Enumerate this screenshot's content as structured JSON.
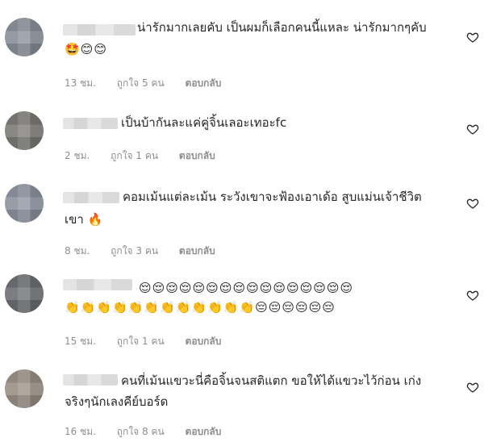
{
  "comments": [
    {
      "avatar_color": "#8a8f9a",
      "text_lines": [
        "น่ารักมากเลยคับ เป็นผมก็เลือกคนนี้แหละ น่ารักมากๆคับ"
      ],
      "emoji_line": "🤩😊😊",
      "time": "13 ชม.",
      "likes": "ถูกใจ 5 คน",
      "reply": "ตอบกลับ"
    },
    {
      "avatar_color": "#7c7a76",
      "text_lines": [
        "เป็นบ้ากันละแค่คู่จิ้นเลอะเทอะfc"
      ],
      "emoji_line": "",
      "time": "2 ชม.",
      "likes": "ถูกใจ 1 คน",
      "reply": "ตอบกลับ"
    },
    {
      "avatar_color": "#8c929e",
      "text_lines": [
        "คอมเม้นแต่ละเม้น ระวังเขาจะฟ้องเอาเด้อ สูบแม่นเจ้าชีวิต",
        "เขา 🔥"
      ],
      "emoji_line": "",
      "time": "8 ชม.",
      "likes": "ถูกใจ 3 คน",
      "reply": "ตอบกลับ"
    },
    {
      "avatar_color": "#6c6e72",
      "text_lines": [],
      "emoji_line": "😌😌😌😌😌😌😌😌😌😌😌😌😌😌😌😌",
      "emoji_line2": "👏👏👏👏👏👏👏👏👏👏👏👏😔😔😔😔😔😔",
      "time": "15 ชม.",
      "likes": "ถูกใจ 1 คน",
      "reply": "ตอบกลับ"
    },
    {
      "avatar_color": "#9a8f84",
      "text_lines": [
        "คนที่เม้นแขวะนี่คือจิ้นจนสติแตก ขอให้ได้แขวะไว้ก่อน เก่ง",
        "จริงๆนักเลงคีย์บอร์ด"
      ],
      "emoji_line": "",
      "time": "16 ชม.",
      "likes": "ถูกใจ 8 คน",
      "reply": "ตอบกลับ"
    }
  ],
  "icons": {
    "heart": "heart-outline-icon"
  }
}
